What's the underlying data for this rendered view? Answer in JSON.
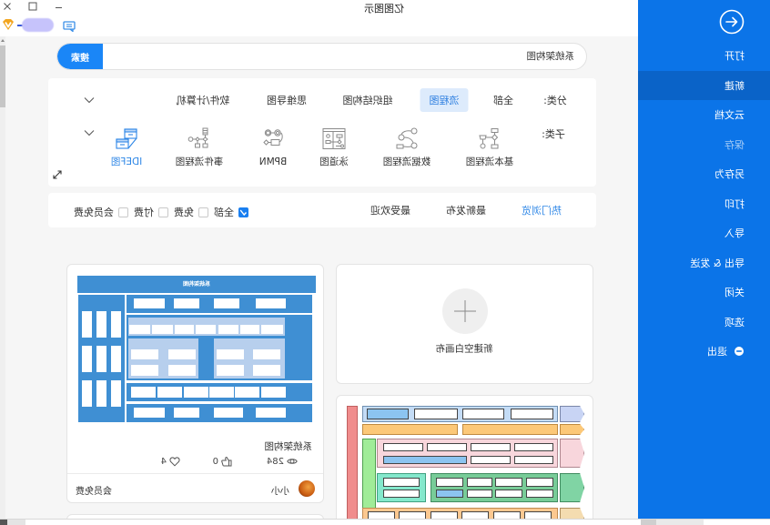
{
  "window": {
    "title": "亿图图示"
  },
  "sidebar": {
    "items": [
      {
        "label": "打开"
      },
      {
        "label": "新建",
        "selected": true
      },
      {
        "label": "云文档"
      },
      {
        "label": "保存",
        "disabled": true
      },
      {
        "label": "另存为"
      },
      {
        "label": "打印"
      },
      {
        "label": "导入"
      },
      {
        "label": "导出 & 发送"
      },
      {
        "label": "关闭"
      },
      {
        "label": "选项"
      },
      {
        "label": "退出",
        "icon": "exit-icon"
      }
    ]
  },
  "search": {
    "value": "系统架构图",
    "button_label": "搜索"
  },
  "category_filter": {
    "label": "分类:",
    "selected": "流程图",
    "items": [
      "全部",
      "流程图",
      "组织结构图",
      "思维导图",
      "软件/计算机"
    ]
  },
  "subcategory_filter": {
    "label": "子类:",
    "selected": "IDEF图",
    "items": [
      {
        "label": "基本流程图",
        "icon": "basic-flowchart-icon"
      },
      {
        "label": "数据流程图",
        "icon": "data-flowchart-icon"
      },
      {
        "label": "泳道图",
        "icon": "swimlane-icon"
      },
      {
        "label": "BPMN",
        "icon": "bpmn-icon"
      },
      {
        "label": "事件流程图",
        "icon": "event-flowchart-icon"
      },
      {
        "label": "IDEF图",
        "icon": "idef-icon"
      }
    ]
  },
  "sort_tabs": {
    "selected": "热门浏览",
    "items": [
      "热门浏览",
      "最新发布",
      "最受欢迎"
    ]
  },
  "price_filter": {
    "items": [
      {
        "label": "全部",
        "checked": true
      },
      {
        "label": "免费",
        "checked": false
      },
      {
        "label": "付费",
        "checked": false
      },
      {
        "label": "会员免费",
        "checked": false
      }
    ]
  },
  "blank_canvas": {
    "label": "新建空白画布"
  },
  "templates": [
    {
      "title": "系统架构图",
      "thumbnail_title": "系统架构图",
      "views": "284",
      "likes": "0",
      "favorites": "4",
      "author": "小小",
      "price": "会员免费"
    }
  ],
  "colors": {
    "sidebar": "#0b74e8",
    "sidebar_selected": "#0a63c8",
    "accent": "#1a86f7",
    "selected_pill_bg": "#ddebfc",
    "selected_text": "#2d86e6"
  }
}
